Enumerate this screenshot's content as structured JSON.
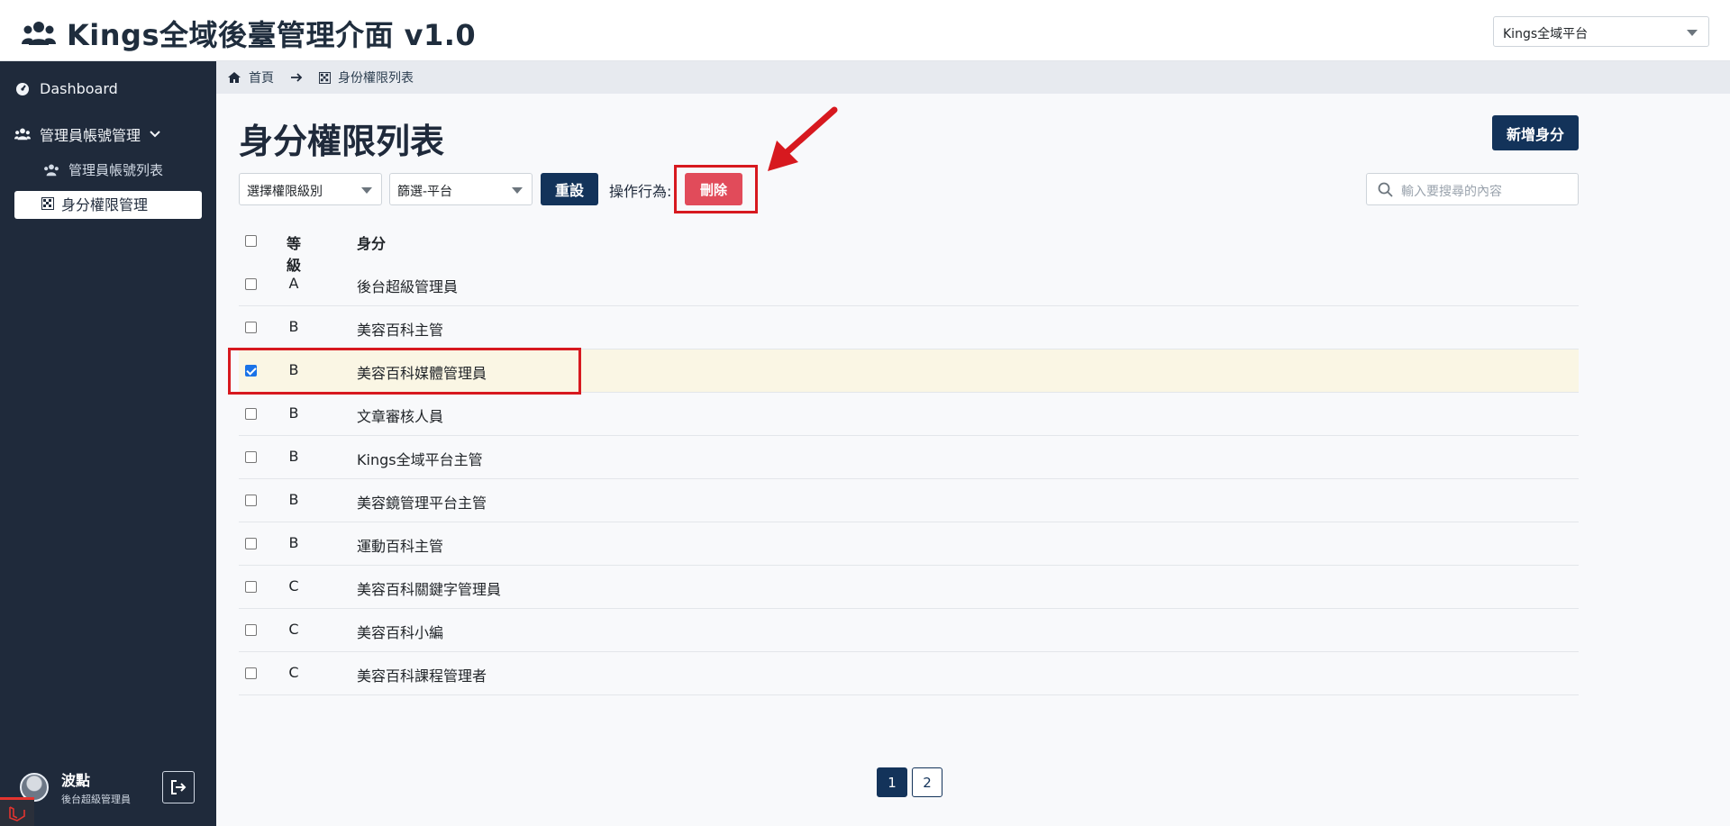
{
  "app": {
    "title": "Kings全域後臺管理介面 v1.0"
  },
  "header": {
    "platform_select": "Kings全域平台"
  },
  "sidebar": {
    "items": [
      {
        "label": "Dashboard"
      },
      {
        "label": "管理員帳號管理"
      },
      {
        "label": "管理員帳號列表"
      },
      {
        "label": "身分權限管理"
      }
    ],
    "user": {
      "name": "波點",
      "role": "後台超級管理員"
    }
  },
  "breadcrumb": {
    "home": "首頁",
    "current": "身份權限列表"
  },
  "main": {
    "title": "身分權限列表",
    "add_button": "新增身分",
    "filter_level": "選擇權限級別",
    "filter_platform": "篩選-平台",
    "reset_button": "重設",
    "action_label": "操作行為:",
    "delete_button": "刪除",
    "search_placeholder": "輸入要搜尋的內容"
  },
  "table": {
    "headers": {
      "level": "等級",
      "role": "身分"
    },
    "rows": [
      {
        "level": "A",
        "role": "後台超級管理員",
        "checked": false
      },
      {
        "level": "B",
        "role": "美容百科主管",
        "checked": false
      },
      {
        "level": "B",
        "role": "美容百科媒體管理員",
        "checked": true
      },
      {
        "level": "B",
        "role": "文章審核人員",
        "checked": false
      },
      {
        "level": "B",
        "role": "Kings全域平台主管",
        "checked": false
      },
      {
        "level": "B",
        "role": "美容鏡管理平台主管",
        "checked": false
      },
      {
        "level": "B",
        "role": "運動百科主管",
        "checked": false
      },
      {
        "level": "C",
        "role": "美容百科關鍵字管理員",
        "checked": false
      },
      {
        "level": "C",
        "role": "美容百科小編",
        "checked": false
      },
      {
        "level": "C",
        "role": "美容百科課程管理者",
        "checked": false
      }
    ]
  },
  "pagination": {
    "pages": [
      "1",
      "2"
    ],
    "current": "1"
  },
  "colors": {
    "sidebar_bg": "#1f2a3b",
    "primary": "#13335a",
    "danger": "#e14b5a",
    "annotation": "#d7191f",
    "selected_row": "#faf6e4"
  }
}
